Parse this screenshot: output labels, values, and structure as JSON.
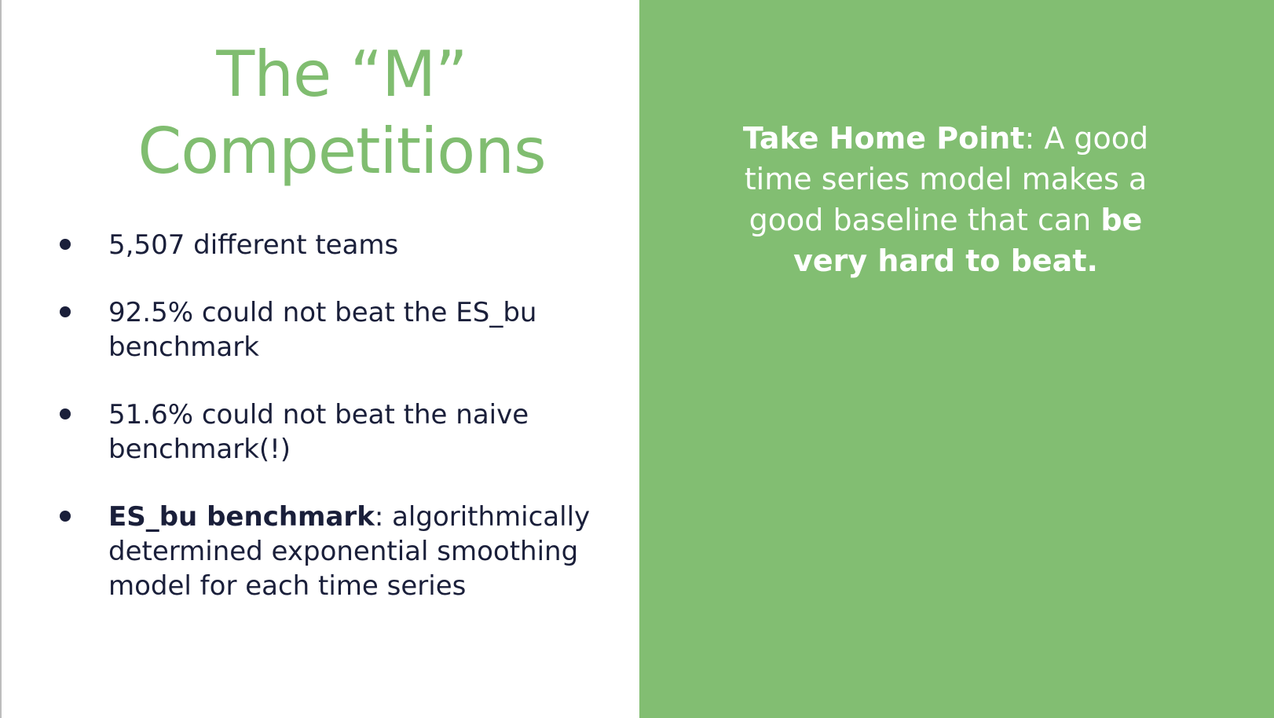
{
  "slide": {
    "title_line1": "The “M”",
    "title_line2": "Competitions",
    "bullets": [
      {
        "text": "5,507 different teams"
      },
      {
        "text": "92.5% could not beat the ES_bu benchmark"
      },
      {
        "text": "51.6% could not beat the naive benchmark(!)"
      },
      {
        "bold": "ES_bu benchmark",
        "text": ":  algorithmically determined exponential smoothing model for each time series"
      }
    ],
    "takehome": {
      "label": "Take Home Point",
      "sep": ":  ",
      "text": "A good time series model makes a good baseline that can ",
      "emphasis": "be very hard to beat."
    },
    "colors": {
      "accent_green": "#80bd70",
      "panel_green": "#82be72",
      "body_text": "#1a1f3a"
    }
  }
}
